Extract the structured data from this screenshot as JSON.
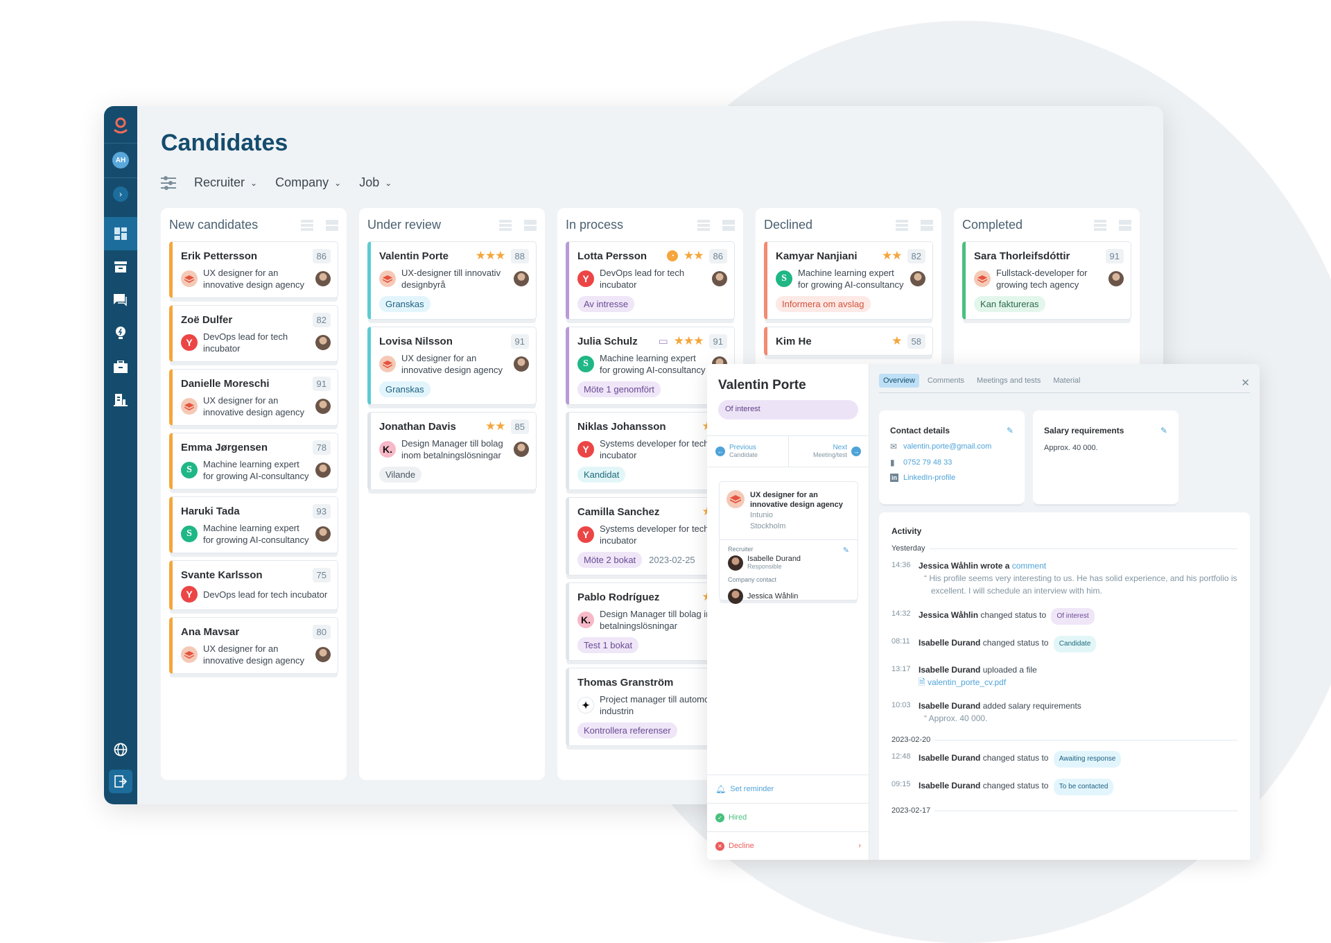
{
  "page": {
    "title": "Candidates"
  },
  "sidebar": {
    "user_initials": "AH",
    "items": [
      {
        "name": "dashboard",
        "active": true
      },
      {
        "name": "archive"
      },
      {
        "name": "messages"
      },
      {
        "name": "ideas"
      },
      {
        "name": "jobs"
      },
      {
        "name": "companies"
      }
    ]
  },
  "filters": [
    {
      "label": "Recruiter"
    },
    {
      "label": "Company"
    },
    {
      "label": "Job"
    }
  ],
  "colors": {
    "new": "#f4a63c",
    "review": "#5ccbd2",
    "process": "#b89ad6",
    "declined": "#f48a72",
    "completed": "#49c07e"
  },
  "columns": [
    {
      "title": "New candidates",
      "accent": "#f4a63c",
      "cards": [
        {
          "name": "Erik Pettersson",
          "score": "86",
          "job": "UX designer for an innovative design agency",
          "logo": "stack"
        },
        {
          "name": "Zoë Dulfer",
          "score": "82",
          "job": "DevOps lead for tech incubator",
          "logo": "y"
        },
        {
          "name": "Danielle Moreschi",
          "score": "91",
          "job": "UX designer for an innovative design agency",
          "logo": "stack"
        },
        {
          "name": "Emma Jørgensen",
          "score": "78",
          "job": "Machine learning expert for growing AI-consultancy",
          "logo": "s"
        },
        {
          "name": "Haruki Tada",
          "score": "93",
          "job": "Machine learning expert for growing AI-consultancy",
          "logo": "s"
        },
        {
          "name": "Svante Karlsson",
          "score": "75",
          "job": "DevOps lead for tech incubator",
          "logo": "y",
          "no_avatar": true
        },
        {
          "name": "Ana Mavsar",
          "score": "80",
          "job": "UX designer for an innovative design agency",
          "logo": "stack"
        }
      ]
    },
    {
      "title": "Under review",
      "accent": "#5ccbd2",
      "cards": [
        {
          "name": "Valentin Porte",
          "stars": "★★★",
          "score": "88",
          "job": "UX-designer till innovativ designbyrå",
          "logo": "stack",
          "tag": "Granskas",
          "tag_style": "blue"
        },
        {
          "name": "Lovisa Nilsson",
          "score": "91",
          "job": "UX designer for an innovative design agency",
          "logo": "stack",
          "tag": "Granskas",
          "tag_style": "blue"
        },
        {
          "name": "Jonathan Davis",
          "stars": "★★",
          "score": "85",
          "job": "Design Manager till bolag inom betalningslösningar",
          "logo": "k",
          "tag": "Vilande",
          "tag_style": "grey",
          "accent": "#dfe5ea"
        }
      ]
    },
    {
      "title": "In process",
      "accent": "#b89ad6",
      "cards": [
        {
          "name": "Lotta Persson",
          "icon": "clock",
          "stars": "★★",
          "score": "86",
          "job": "DevOps lead for tech incubator",
          "logo": "y",
          "tag": "Av intresse",
          "tag_style": "purple"
        },
        {
          "name": "Julia Schulz",
          "icon": "comment",
          "stars": "★★★",
          "score": "91",
          "job": "Machine learning expert for growing AI-consultancy",
          "logo": "s",
          "tag": "Möte 1 genomfört",
          "tag_style": "purple"
        },
        {
          "name": "Niklas Johansson",
          "stars": "★★",
          "job": "Systems developer for tech incubator",
          "logo": "y",
          "tag": "Kandidat",
          "tag_style": "cyan",
          "accent": "#dfe5ea",
          "no_avatar": true
        },
        {
          "name": "Camilla Sanchez",
          "stars": "★★",
          "job": "Systems developer for tech incubator",
          "logo": "y",
          "tag": "Möte 2 bokat",
          "tag_style": "purple",
          "date": "2023-02-25",
          "accent": "#dfe5ea",
          "no_avatar": true
        },
        {
          "name": "Pablo Rodríguez",
          "stars": "★★",
          "job": "Design Manager till bolag inom betalningslösningar",
          "logo": "k",
          "tag": "Test 1 bokat",
          "tag_style": "purple",
          "accent": "#dfe5ea",
          "no_avatar": true
        },
        {
          "name": "Thomas Granström",
          "job": "Project manager till automotive industrin",
          "logo": "star4",
          "tag": "Kontrollera referenser",
          "tag_style": "purple",
          "accent": "#dfe5ea",
          "no_avatar": true
        }
      ]
    },
    {
      "title": "Declined",
      "accent": "#f48a72",
      "cards": [
        {
          "name": "Kamyar Nanjiani",
          "stars": "★★",
          "score": "82",
          "job": "Machine learning expert for growing AI-consultancy",
          "logo": "s",
          "tag": "Informera om avslag",
          "tag_style": "red"
        },
        {
          "name": "Kim He",
          "stars": "★",
          "score": "58",
          "job": "",
          "logo": "",
          "no_avatar": true
        }
      ]
    },
    {
      "title": "Completed",
      "accent": "#49c07e",
      "cards": [
        {
          "name": "Sara Thorleifsdóttir",
          "score": "91",
          "job": "Fullstack-developer for growing tech agency",
          "logo": "stack",
          "tag": "Kan faktureras",
          "tag_style": "green"
        }
      ]
    }
  ],
  "detail": {
    "name": "Valentin Porte",
    "status": "Of interest",
    "prev": {
      "label": "Previous",
      "sub": "Candidate"
    },
    "next": {
      "label": "Next",
      "sub": "Meeting/test"
    },
    "job": {
      "title": "UX designer for an innovative design agency",
      "company": "Intunio",
      "city": "Stockholm"
    },
    "recruiter_label": "Recruiter",
    "recruiter": {
      "name": "Isabelle Durand",
      "role": "Responsible"
    },
    "contact_label": "Company contact",
    "contact": {
      "name": "Jessica Wåhlin"
    },
    "actions": [
      {
        "label": "Set reminder",
        "color": "#4ea3d8"
      },
      {
        "label": "Hired",
        "color": "#49c07e"
      },
      {
        "label": "Decline",
        "color": "#ec5a5a"
      }
    ],
    "tabs": [
      {
        "label": "Overview",
        "active": true
      },
      {
        "label": "Comments"
      },
      {
        "label": "Meetings and tests"
      },
      {
        "label": "Material"
      }
    ],
    "contact_details": {
      "title": "Contact details",
      "email": "valentin.porte@gmail.com",
      "phone": "0752 79 48 33",
      "linkedin": "LinkedIn-profile"
    },
    "salary": {
      "title": "Salary requirements",
      "value": "Approx. 40 000."
    },
    "activity": {
      "title": "Activity",
      "groups": [
        {
          "day": "Yesterday",
          "events": [
            {
              "time": "14:36",
              "who": "Jessica Wåhlin",
              "action": "wrote a",
              "link": "comment",
              "quote": "His profile seems very interesting to us. He has solid experience, and his portfolio is excellent. I will schedule an interview with him."
            },
            {
              "time": "14:32",
              "who": "Jessica Wåhlin",
              "action": "changed status to",
              "tag": "Of interest",
              "tag_style": "purple"
            },
            {
              "time": "08:11",
              "who": "Isabelle Durand",
              "action": "changed status to",
              "tag": "Candidate",
              "tag_style": "cyan"
            },
            {
              "time": "13:17",
              "who": "Isabelle Durand",
              "action": "uploaded a file",
              "file": "valentin_porte_cv.pdf"
            },
            {
              "time": "10:03",
              "who": "Isabelle Durand",
              "action": "added salary requirements",
              "quote": "Approx. 40 000."
            }
          ]
        },
        {
          "day": "2023-02-20",
          "events": [
            {
              "time": "12:48",
              "who": "Isabelle Durand",
              "action": "changed status to",
              "tag": "Awaiting response",
              "tag_style": "blue"
            },
            {
              "time": "09:15",
              "who": "Isabelle Durand",
              "action": "changed status to",
              "tag": "To be contacted",
              "tag_style": "blue"
            }
          ]
        },
        {
          "day": "2023-02-17",
          "events": []
        }
      ]
    }
  }
}
